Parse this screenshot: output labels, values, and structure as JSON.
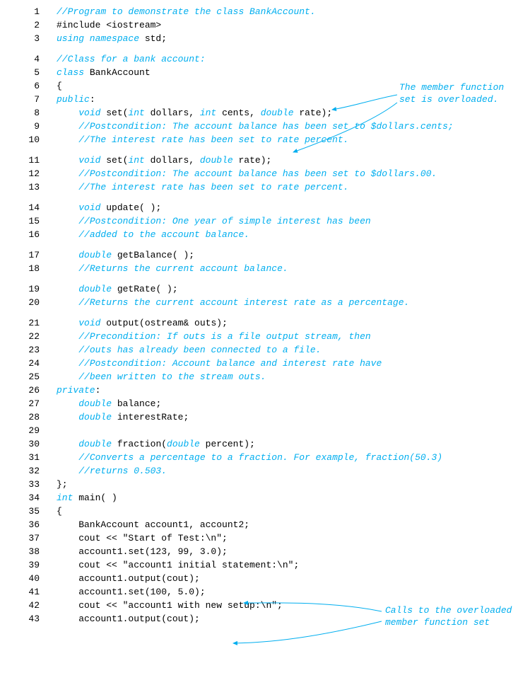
{
  "lines": [
    {
      "n": "1",
      "gapAfter": false,
      "tokens": [
        {
          "c": "cm",
          "t": "//Program to demonstrate the class BankAccount."
        }
      ]
    },
    {
      "n": "2",
      "gapAfter": false,
      "tokens": [
        {
          "c": "pl",
          "t": "#include <iostream>"
        }
      ]
    },
    {
      "n": "3",
      "gapAfter": true,
      "tokens": [
        {
          "c": "kw",
          "t": "using namespace"
        },
        {
          "c": "pl",
          "t": " std;"
        }
      ]
    },
    {
      "n": "4",
      "gapAfter": false,
      "tokens": [
        {
          "c": "cm",
          "t": "//Class for a bank account:"
        }
      ]
    },
    {
      "n": "5",
      "gapAfter": false,
      "tokens": [
        {
          "c": "kw",
          "t": "class"
        },
        {
          "c": "pl",
          "t": " BankAccount"
        }
      ]
    },
    {
      "n": "6",
      "gapAfter": false,
      "tokens": [
        {
          "c": "pl",
          "t": "{"
        }
      ]
    },
    {
      "n": "7",
      "gapAfter": false,
      "tokens": [
        {
          "c": "kw",
          "t": "public"
        },
        {
          "c": "pl",
          "t": ":"
        }
      ]
    },
    {
      "n": "8",
      "gapAfter": false,
      "tokens": [
        {
          "c": "pl",
          "t": "    "
        },
        {
          "c": "kw",
          "t": "void"
        },
        {
          "c": "pl",
          "t": " set("
        },
        {
          "c": "kw",
          "t": "int"
        },
        {
          "c": "pl",
          "t": " dollars, "
        },
        {
          "c": "kw",
          "t": "int"
        },
        {
          "c": "pl",
          "t": " cents, "
        },
        {
          "c": "kw",
          "t": "double"
        },
        {
          "c": "pl",
          "t": " rate);"
        }
      ]
    },
    {
      "n": "9",
      "gapAfter": false,
      "tokens": [
        {
          "c": "pl",
          "t": "    "
        },
        {
          "c": "cm",
          "t": "//Postcondition: The account balance has been set to $dollars.cents;"
        }
      ]
    },
    {
      "n": "10",
      "gapAfter": true,
      "tokens": [
        {
          "c": "pl",
          "t": "    "
        },
        {
          "c": "cm",
          "t": "//The interest rate has been set to rate percent."
        }
      ]
    },
    {
      "n": "11",
      "gapAfter": false,
      "tokens": [
        {
          "c": "pl",
          "t": "    "
        },
        {
          "c": "kw",
          "t": "void"
        },
        {
          "c": "pl",
          "t": " set("
        },
        {
          "c": "kw",
          "t": "int"
        },
        {
          "c": "pl",
          "t": " dollars, "
        },
        {
          "c": "kw",
          "t": "double"
        },
        {
          "c": "pl",
          "t": " rate);"
        }
      ]
    },
    {
      "n": "12",
      "gapAfter": false,
      "tokens": [
        {
          "c": "pl",
          "t": "    "
        },
        {
          "c": "cm",
          "t": "//Postcondition: The account balance has been set to $dollars.00."
        }
      ]
    },
    {
      "n": "13",
      "gapAfter": true,
      "tokens": [
        {
          "c": "pl",
          "t": "    "
        },
        {
          "c": "cm",
          "t": "//The interest rate has been set to rate percent."
        }
      ]
    },
    {
      "n": "14",
      "gapAfter": false,
      "tokens": [
        {
          "c": "pl",
          "t": "    "
        },
        {
          "c": "kw",
          "t": "void"
        },
        {
          "c": "pl",
          "t": " update( );"
        }
      ]
    },
    {
      "n": "15",
      "gapAfter": false,
      "tokens": [
        {
          "c": "pl",
          "t": "    "
        },
        {
          "c": "cm",
          "t": "//Postcondition: One year of simple interest has been"
        }
      ]
    },
    {
      "n": "16",
      "gapAfter": true,
      "tokens": [
        {
          "c": "pl",
          "t": "    "
        },
        {
          "c": "cm",
          "t": "//added to the account balance."
        }
      ]
    },
    {
      "n": "17",
      "gapAfter": false,
      "tokens": [
        {
          "c": "pl",
          "t": "    "
        },
        {
          "c": "kw",
          "t": "double"
        },
        {
          "c": "pl",
          "t": " getBalance( );"
        }
      ]
    },
    {
      "n": "18",
      "gapAfter": true,
      "tokens": [
        {
          "c": "pl",
          "t": "    "
        },
        {
          "c": "cm",
          "t": "//Returns the current account balance."
        }
      ]
    },
    {
      "n": "19",
      "gapAfter": false,
      "tokens": [
        {
          "c": "pl",
          "t": "    "
        },
        {
          "c": "kw",
          "t": "double"
        },
        {
          "c": "pl",
          "t": " getRate( );"
        }
      ]
    },
    {
      "n": "20",
      "gapAfter": true,
      "tokens": [
        {
          "c": "pl",
          "t": "    "
        },
        {
          "c": "cm",
          "t": "//Returns the current account interest rate as a percentage."
        }
      ]
    },
    {
      "n": "21",
      "gapAfter": false,
      "tokens": [
        {
          "c": "pl",
          "t": "    "
        },
        {
          "c": "kw",
          "t": "void"
        },
        {
          "c": "pl",
          "t": " output(ostream& outs);"
        }
      ]
    },
    {
      "n": "22",
      "gapAfter": false,
      "tokens": [
        {
          "c": "pl",
          "t": "    "
        },
        {
          "c": "cm",
          "t": "//Precondition: If outs is a file output stream, then"
        }
      ]
    },
    {
      "n": "23",
      "gapAfter": false,
      "tokens": [
        {
          "c": "pl",
          "t": "    "
        },
        {
          "c": "cm",
          "t": "//outs has already been connected to a file."
        }
      ]
    },
    {
      "n": "24",
      "gapAfter": false,
      "tokens": [
        {
          "c": "pl",
          "t": "    "
        },
        {
          "c": "cm",
          "t": "//Postcondition: Account balance and interest rate have"
        }
      ]
    },
    {
      "n": "25",
      "gapAfter": false,
      "tokens": [
        {
          "c": "pl",
          "t": "    "
        },
        {
          "c": "cm",
          "t": "//been written to the stream outs."
        }
      ]
    },
    {
      "n": "26",
      "gapAfter": false,
      "tokens": [
        {
          "c": "kw",
          "t": "private"
        },
        {
          "c": "pl",
          "t": ":"
        }
      ]
    },
    {
      "n": "27",
      "gapAfter": false,
      "tokens": [
        {
          "c": "pl",
          "t": "    "
        },
        {
          "c": "kw",
          "t": "double"
        },
        {
          "c": "pl",
          "t": " balance;"
        }
      ]
    },
    {
      "n": "28",
      "gapAfter": false,
      "tokens": [
        {
          "c": "pl",
          "t": "    "
        },
        {
          "c": "kw",
          "t": "double"
        },
        {
          "c": "pl",
          "t": " interestRate;"
        }
      ]
    },
    {
      "n": "29",
      "gapAfter": false,
      "tokens": [
        {
          "c": "pl",
          "t": ""
        }
      ]
    },
    {
      "n": "30",
      "gapAfter": false,
      "tokens": [
        {
          "c": "pl",
          "t": "    "
        },
        {
          "c": "kw",
          "t": "double"
        },
        {
          "c": "pl",
          "t": " fraction("
        },
        {
          "c": "kw",
          "t": "double"
        },
        {
          "c": "pl",
          "t": " percent);"
        }
      ]
    },
    {
      "n": "31",
      "gapAfter": false,
      "tokens": [
        {
          "c": "pl",
          "t": "    "
        },
        {
          "c": "cm",
          "t": "//Converts a percentage to a fraction. For example, fraction(50.3)"
        }
      ]
    },
    {
      "n": "32",
      "gapAfter": false,
      "tokens": [
        {
          "c": "pl",
          "t": "    "
        },
        {
          "c": "cm",
          "t": "//returns 0.503."
        }
      ]
    },
    {
      "n": "33",
      "gapAfter": false,
      "tokens": [
        {
          "c": "pl",
          "t": "};"
        }
      ]
    },
    {
      "n": "34",
      "gapAfter": false,
      "tokens": [
        {
          "c": "kw",
          "t": "int"
        },
        {
          "c": "pl",
          "t": " main( )"
        }
      ]
    },
    {
      "n": "35",
      "gapAfter": false,
      "tokens": [
        {
          "c": "pl",
          "t": "{"
        }
      ]
    },
    {
      "n": "36",
      "gapAfter": false,
      "tokens": [
        {
          "c": "pl",
          "t": "    BankAccount account1, account2;"
        }
      ]
    },
    {
      "n": "37",
      "gapAfter": false,
      "tokens": [
        {
          "c": "pl",
          "t": "    cout << \"Start of Test:\\n\";"
        }
      ]
    },
    {
      "n": "38",
      "gapAfter": false,
      "tokens": [
        {
          "c": "pl",
          "t": "    account1.set(123, 99, 3.0);"
        }
      ]
    },
    {
      "n": "39",
      "gapAfter": false,
      "tokens": [
        {
          "c": "pl",
          "t": "    cout << \"account1 initial statement:\\n\";"
        }
      ]
    },
    {
      "n": "40",
      "gapAfter": false,
      "tokens": [
        {
          "c": "pl",
          "t": "    account1.output(cout);"
        }
      ]
    },
    {
      "n": "41",
      "gapAfter": false,
      "tokens": [
        {
          "c": "pl",
          "t": "    account1.set(100, 5.0);"
        }
      ]
    },
    {
      "n": "42",
      "gapAfter": false,
      "tokens": [
        {
          "c": "pl",
          "t": "    cout << \"account1 with new setup:\\n\";"
        }
      ]
    },
    {
      "n": "43",
      "gapAfter": false,
      "tokens": [
        {
          "c": "pl",
          "t": "    account1.output(cout);"
        }
      ]
    }
  ],
  "annotations": {
    "a1_line1": "The member function",
    "a1_line2": "set is overloaded.",
    "a2_line1": "Calls to the overloaded",
    "a2_line2": "member function set"
  }
}
